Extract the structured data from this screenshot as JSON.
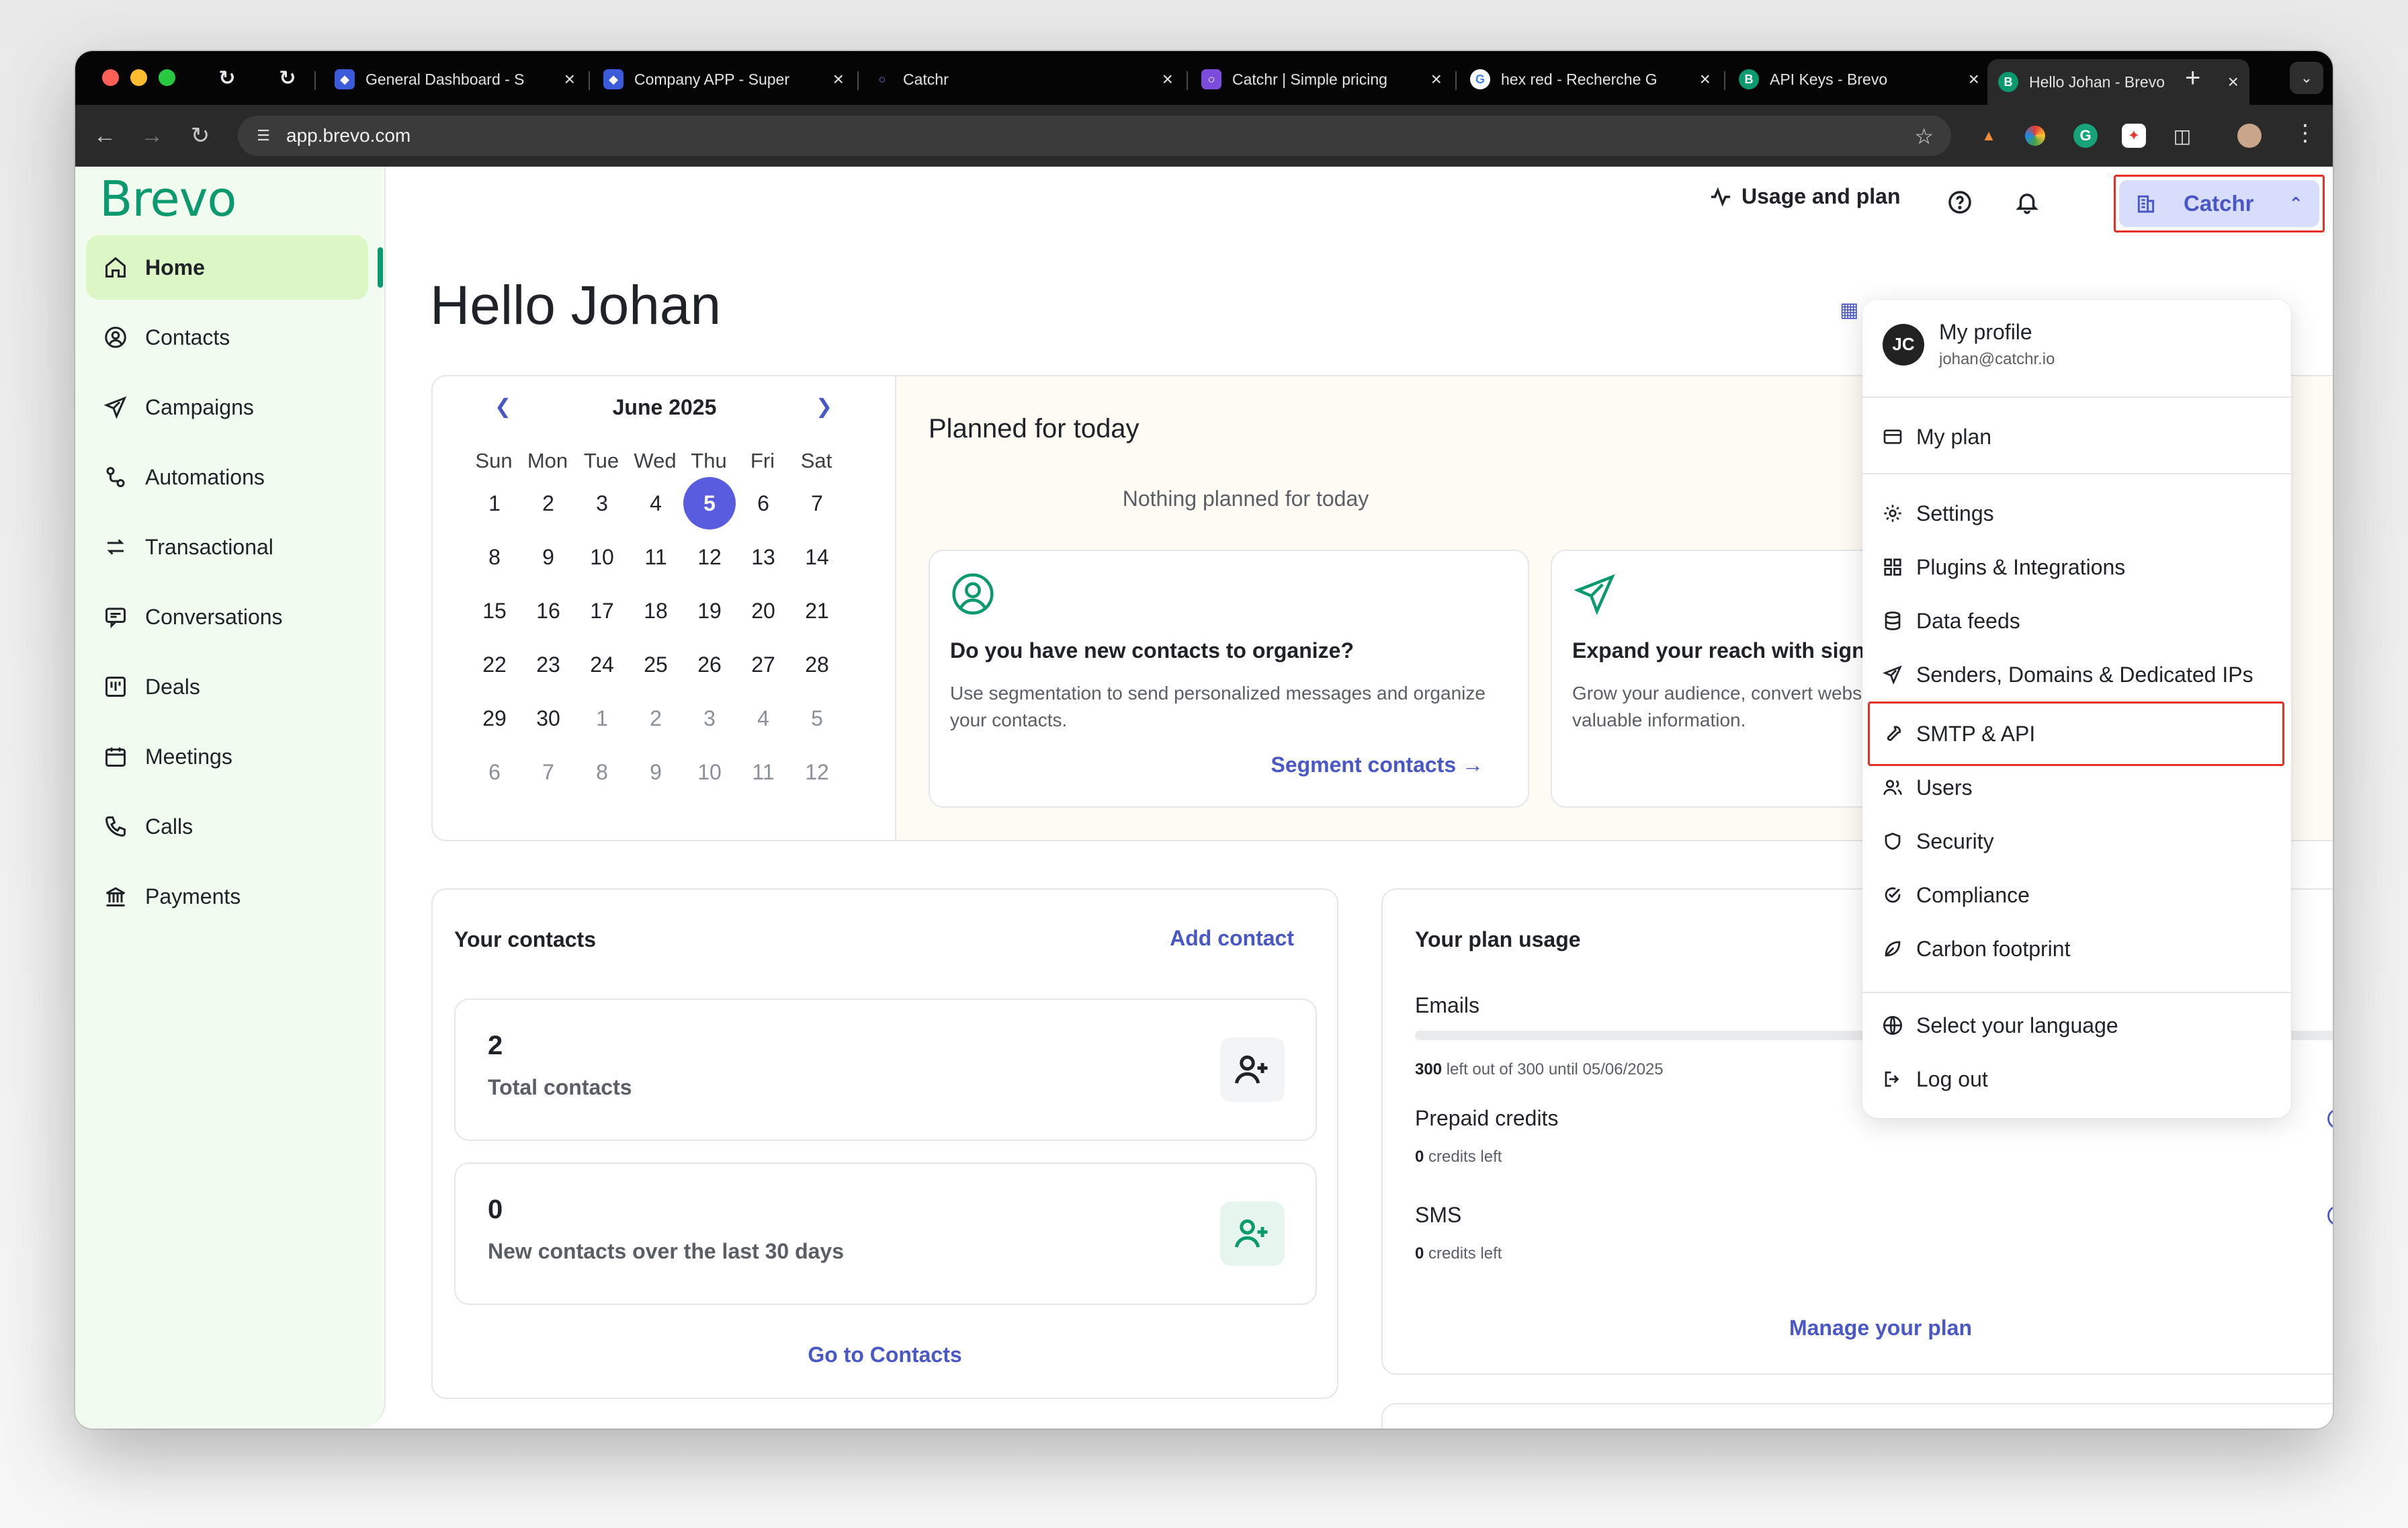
{
  "browser": {
    "tabs": [
      {
        "title": "General Dashboard - S",
        "favicon": "shield-favicon",
        "color": "#3b5bdb"
      },
      {
        "title": "Company APP - Super",
        "favicon": "shield-favicon",
        "color": "#3b5bdb"
      },
      {
        "title": "Catchr",
        "favicon": "catchr-favicon",
        "color": "#6a4bd8"
      },
      {
        "title": "Catchr | Simple pricing",
        "favicon": "catchr-favicon",
        "color": "#7c4ddc"
      },
      {
        "title": "hex red - Recherche G",
        "favicon": "google-favicon",
        "color": "#ffffff"
      },
      {
        "title": "API Keys - Brevo",
        "favicon": "brevo-favicon",
        "color": "#0b996e"
      },
      {
        "title": "Hello Johan - Brevo",
        "favicon": "brevo-favicon",
        "color": "#0b996e"
      }
    ],
    "tab_letters": {
      "brevo": "B",
      "google": "G"
    },
    "url": "app.brevo.com"
  },
  "sidebar": {
    "logo": "Brevo",
    "items": [
      {
        "label": "Home",
        "icon": "home-icon"
      },
      {
        "label": "Contacts",
        "icon": "contacts-icon"
      },
      {
        "label": "Campaigns",
        "icon": "send-icon"
      },
      {
        "label": "Automations",
        "icon": "automations-icon"
      },
      {
        "label": "Transactional",
        "icon": "transactional-icon"
      },
      {
        "label": "Conversations",
        "icon": "chat-icon"
      },
      {
        "label": "Deals",
        "icon": "deals-icon"
      },
      {
        "label": "Meetings",
        "icon": "calendar-icon"
      },
      {
        "label": "Calls",
        "icon": "phone-icon"
      },
      {
        "label": "Payments",
        "icon": "bank-icon"
      }
    ]
  },
  "header": {
    "usage_label": "Usage and plan",
    "account_name": "Catchr"
  },
  "greeting": "Hello Johan",
  "calendar": {
    "month_label": "June 2025",
    "weekdays": [
      "Sun",
      "Mon",
      "Tue",
      "Wed",
      "Thu",
      "Fri",
      "Sat"
    ],
    "weeks": [
      [
        "1",
        "2",
        "3",
        "4",
        "5",
        "6",
        "7"
      ],
      [
        "8",
        "9",
        "10",
        "11",
        "12",
        "13",
        "14"
      ],
      [
        "15",
        "16",
        "17",
        "18",
        "19",
        "20",
        "21"
      ],
      [
        "22",
        "23",
        "24",
        "25",
        "26",
        "27",
        "28"
      ],
      [
        "29",
        "30",
        "1",
        "2",
        "3",
        "4",
        "5"
      ],
      [
        "6",
        "7",
        "8",
        "9",
        "10",
        "11",
        "12"
      ]
    ],
    "selected_day": "5"
  },
  "planned": {
    "title": "Planned for today",
    "empty_text": "Nothing planned for today",
    "suggestions": [
      {
        "title": "Do you have new contacts to organize?",
        "description": "Use segmentation to send personalized messages and organize your contacts.",
        "link": "Segment contacts →"
      },
      {
        "title": "Expand your reach with signup forms",
        "description": "Grow your audience, convert website visitors and collect valuable information.",
        "link": ""
      }
    ]
  },
  "contacts": {
    "title": "Your contacts",
    "add_label": "Add contact",
    "total_value": "2",
    "total_label": "Total contacts",
    "new_value": "0",
    "new_label": "New contacts over the last 30 days",
    "go_label": "Go to Contacts"
  },
  "plan_usage": {
    "title": "Your plan usage",
    "emails_label": "Emails",
    "emails_used_fraction": 0.0,
    "emails_left": "300",
    "emails_sub": " left out of 300 until 05/06/2025",
    "prepaid_label": "Prepaid credits",
    "prepaid_value": "0",
    "prepaid_sub": " credits left",
    "sms_label": "SMS",
    "sms_value": "0",
    "sms_sub": " credits left",
    "manage_label": "Manage your plan"
  },
  "account_menu": {
    "initials": "JC",
    "profile_label": "My profile",
    "email": "johan@catchr.io",
    "items": [
      {
        "label": "My plan",
        "icon": "card-icon"
      },
      {
        "label": "Settings",
        "icon": "gear-icon"
      },
      {
        "label": "Plugins & Integrations",
        "icon": "grid-icon"
      },
      {
        "label": "Data feeds",
        "icon": "database-icon"
      },
      {
        "label": "Senders, Domains & Dedicated IPs",
        "icon": "send-icon"
      },
      {
        "label": "SMTP & API",
        "icon": "wrench-icon"
      },
      {
        "label": "Users",
        "icon": "users-icon"
      },
      {
        "label": "Security",
        "icon": "shield-icon"
      },
      {
        "label": "Compliance",
        "icon": "check-circle-icon"
      },
      {
        "label": "Carbon footprint",
        "icon": "leaf-icon"
      },
      {
        "label": "Select your language",
        "icon": "globe-icon"
      },
      {
        "label": "Log out",
        "icon": "logout-icon"
      }
    ]
  },
  "colors": {
    "brand": "#0b996e",
    "accent": "#4a58c7",
    "highlight": "#e5302a",
    "sidebar_bg": "#f1fbef"
  }
}
